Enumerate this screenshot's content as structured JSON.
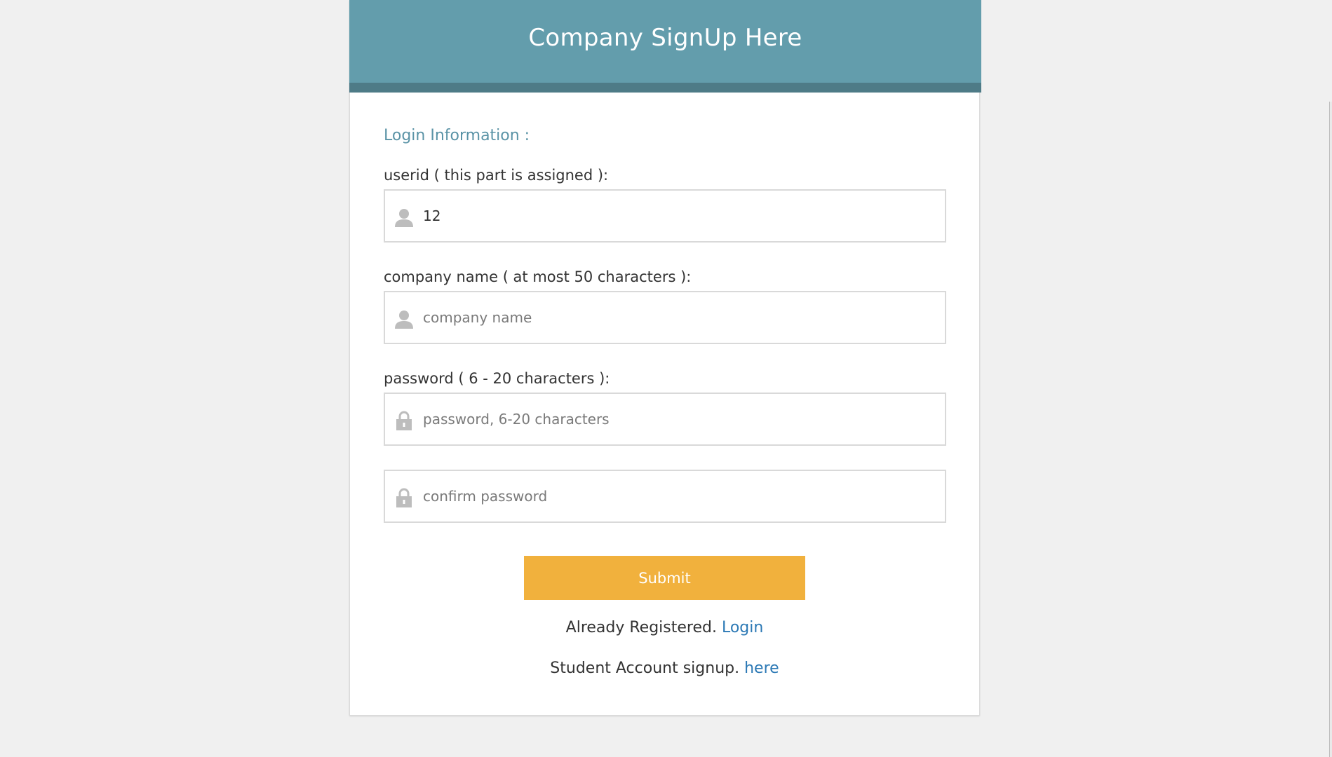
{
  "header": {
    "title": "Company SignUp Here"
  },
  "form": {
    "section_title": "Login Information :",
    "userid": {
      "label": "userid ( this part is assigned ):",
      "value": "12",
      "icon": "user-icon"
    },
    "company_name": {
      "label": "company name ( at most 50 characters ):",
      "placeholder": "company name",
      "icon": "user-icon"
    },
    "password": {
      "label": "password ( 6 - 20 characters ):",
      "placeholder": "password, 6-20 characters",
      "icon": "lock-icon"
    },
    "confirm_password": {
      "placeholder": "confirm password",
      "icon": "lock-icon"
    },
    "submit_label": "Submit"
  },
  "footer": {
    "registered_text": "Already Registered.",
    "login_link": "Login",
    "student_text": "Student Account signup.",
    "student_link": "here"
  },
  "colors": {
    "header": "#639dac",
    "header_band": "#4e7b87",
    "accent_text": "#5a93a6",
    "submit": "#f1b13d",
    "link": "#2c79b5"
  }
}
